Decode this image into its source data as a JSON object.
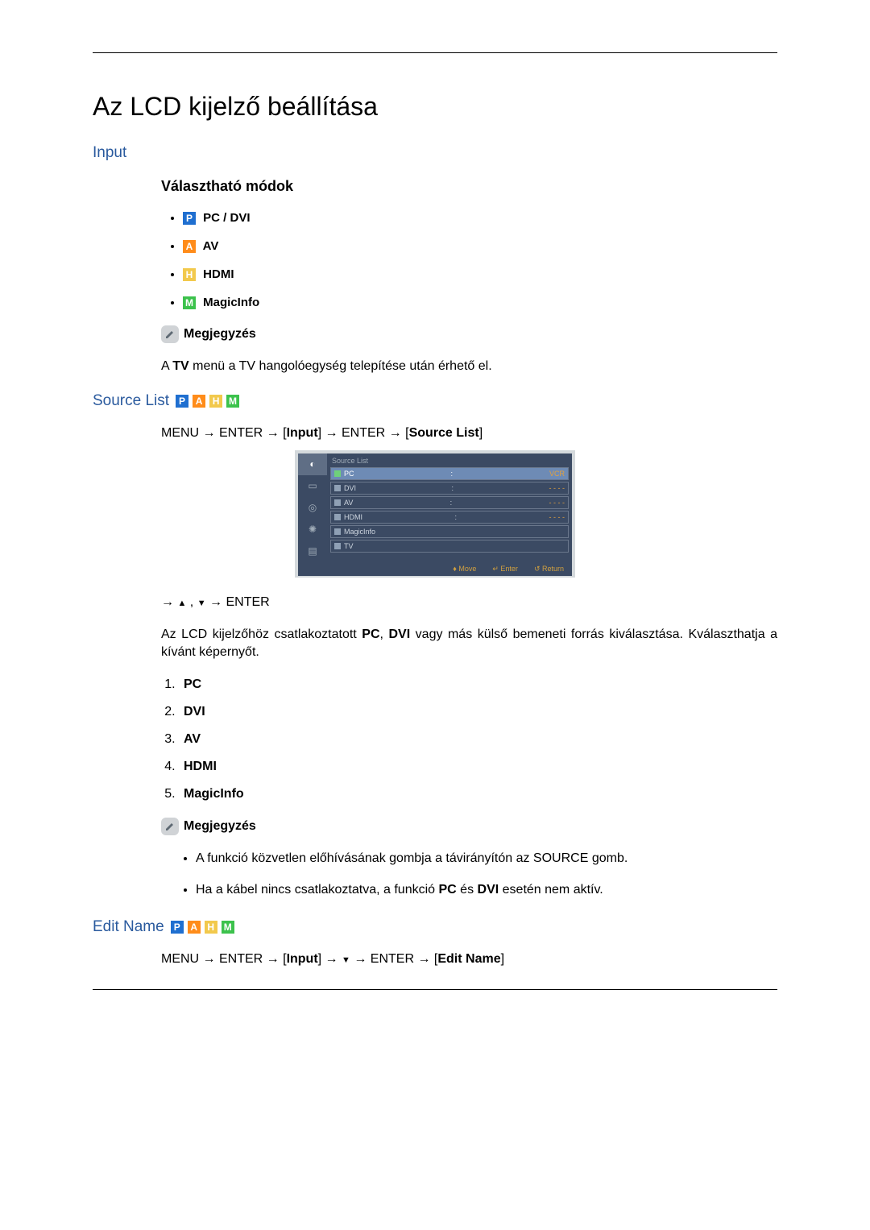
{
  "page_title": "Az LCD kijelző beállítása",
  "input_heading": "Input",
  "modes_heading": "Választható módok",
  "modes": [
    {
      "icon": "P",
      "cls": "p",
      "label": " PC / DVI"
    },
    {
      "icon": "A",
      "cls": "a",
      "label": " AV"
    },
    {
      "icon": "H",
      "cls": "h",
      "label": " HDMI"
    },
    {
      "icon": "M",
      "cls": "m",
      "label": " MagicInfo"
    }
  ],
  "note_label": "Megjegyzés",
  "note1_pre": "A ",
  "note1_bold": "TV",
  "note1_post": " menü a TV hangolóegység telepítése után érhető el.",
  "source_list_heading": "Source List",
  "source_list_path_pre": "MENU → ENTER → [",
  "source_list_path_b1": "Input",
  "source_list_path_mid": "] → ENTER → [",
  "source_list_path_b2": "Source List",
  "source_list_path_post": "]",
  "osd": {
    "title": "Source List",
    "rows": [
      {
        "label": "PC",
        "right": "VCR",
        "checked": true,
        "sel": true
      },
      {
        "label": "DVI",
        "right": "- - - -",
        "checked": false,
        "sel": false
      },
      {
        "label": "AV",
        "right": "- - - -",
        "checked": false,
        "sel": false
      },
      {
        "label": "HDMI",
        "right": "- - - -",
        "checked": false,
        "sel": false
      },
      {
        "label": "MagicInfo",
        "right": "",
        "checked": false,
        "sel": false
      },
      {
        "label": "TV",
        "right": "",
        "checked": false,
        "sel": false
      }
    ],
    "footer": {
      "move": "Move",
      "enter": "Enter",
      "return": "Return"
    }
  },
  "small_nav_post": " → ENTER",
  "desc_pre": "Az LCD kijelzőhöz csatlakoztatott ",
  "desc_b1": "PC",
  "desc_mid1": ", ",
  "desc_b2": "DVI",
  "desc_post": " vagy más külső bemeneti forrás kiválasztása. Kválaszthatja a kívánt képernyőt.",
  "num_list": [
    "PC",
    "DVI",
    "AV",
    "HDMI",
    "MagicInfo"
  ],
  "note_bullets": [
    {
      "pre": "A funkció közvetlen előhívásának gombja a távirányítón az SOURCE gomb."
    },
    {
      "pre": "Ha a kábel nincs csatlakoztatva, a funkció ",
      "b1": "PC",
      "mid": " és ",
      "b2": "DVI",
      "post": " esetén nem aktív."
    }
  ],
  "edit_name_heading": "Edit Name",
  "edit_name_path_pre": "MENU → ENTER → [",
  "edit_name_path_b1": "Input",
  "edit_name_path_mid1": "] → ",
  "edit_name_path_mid2": " → ENTER → [",
  "edit_name_path_b2": "Edit Name",
  "edit_name_path_post": "]"
}
